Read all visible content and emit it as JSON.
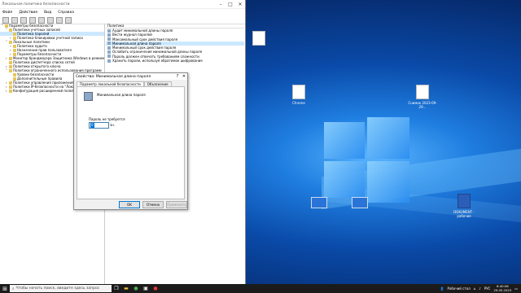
{
  "mmc": {
    "title": "Локальная политика безопасности",
    "menu": [
      "Файл",
      "Действие",
      "Вид",
      "Справка"
    ],
    "tree": [
      {
        "label": "Параметры безопасности",
        "level": 0,
        "expand": "v"
      },
      {
        "label": "Политики учетных записей",
        "level": 1,
        "expand": "v"
      },
      {
        "label": "Политика паролей",
        "level": 2,
        "expand": "",
        "selected": true
      },
      {
        "label": "Политика блокировки учетной записи",
        "level": 2,
        "expand": ">"
      },
      {
        "label": "Локальные политики",
        "level": 1,
        "expand": "v"
      },
      {
        "label": "Политика аудита",
        "level": 2,
        "expand": ">"
      },
      {
        "label": "Назначение прав пользователя",
        "level": 2,
        "expand": ">"
      },
      {
        "label": "Параметры безопасности",
        "level": 2,
        "expand": ">"
      },
      {
        "label": "Монитор брандмауэра Защитника Windows в режиме повыш",
        "level": 1,
        "expand": ">"
      },
      {
        "label": "Политики диспетчера списка сетей",
        "level": 1,
        "expand": ""
      },
      {
        "label": "Политики открытого ключа",
        "level": 1,
        "expand": ">"
      },
      {
        "label": "Политики ограниченного использования программ",
        "level": 1,
        "expand": "v"
      },
      {
        "label": "Уровни безопасности",
        "level": 2,
        "expand": ""
      },
      {
        "label": "Дополнительные правила",
        "level": 2,
        "expand": ""
      },
      {
        "label": "Политики управления приложениями",
        "level": 1,
        "expand": ">"
      },
      {
        "label": "Политики IP-безопасности на \"Локальный",
        "level": 1,
        "expand": ">"
      },
      {
        "label": "Конфигурация расширенной политики аудита",
        "level": 1,
        "expand": ">"
      }
    ],
    "policy_header": "Политика",
    "policies": [
      {
        "label": "Аудит минимальной длины пароля",
        "selected": false
      },
      {
        "label": "Вести журнал паролей",
        "selected": false
      },
      {
        "label": "Максимальный срок действия пароля",
        "selected": false
      },
      {
        "label": "Минимальная длина пароля",
        "selected": true
      },
      {
        "label": "Минимальный срок действия пароля",
        "selected": false
      },
      {
        "label": "Ослабить ограничения минимальной длины пароля",
        "selected": false
      },
      {
        "label": "Пароль должен отвечать требованиям сложности",
        "selected": false
      },
      {
        "label": "Хранить пароли, используя обратимое шифрование",
        "selected": false
      }
    ]
  },
  "dialog": {
    "title": "Свойства: Минимальная длина пароля",
    "tabs": [
      "Параметр локальной безопасности",
      "Объяснение"
    ],
    "policy_name": "Минимальная длина пароля",
    "field_label": "Пароль не требуется",
    "value": "0",
    "unit": "зн.",
    "buttons": [
      "ОК",
      "Отмена",
      "Применить"
    ]
  },
  "desktop_icons": [
    {
      "label": "",
      "type": "doc"
    },
    {
      "label": "Chrome",
      "type": "doc"
    },
    {
      "label": "Снимок 2023-09-29...",
      "type": "doc"
    },
    {
      "label": "",
      "type": "shot"
    },
    {
      "label": "",
      "type": "shot"
    },
    {
      "label": "DOKUMENT - рабочие",
      "type": "word"
    }
  ],
  "taskbar": {
    "search_placeholder": "Чтобы начать поиск, введите здесь запрос",
    "tray_text": "Рабочий стол",
    "lang": "РУС",
    "time": "6:40:06",
    "date": "29.05.2023"
  }
}
